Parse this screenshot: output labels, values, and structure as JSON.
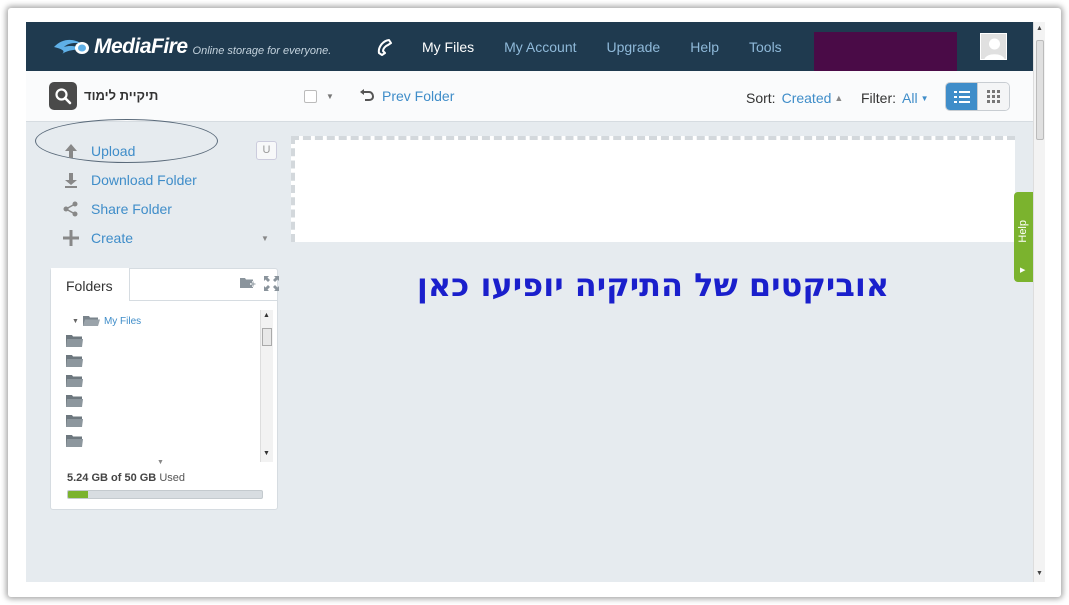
{
  "nav": {
    "brand": "MediaFire",
    "tagline": "Online storage for everyone.",
    "links": [
      {
        "label": "My Files",
        "active": true
      },
      {
        "label": "My Account"
      },
      {
        "label": "Upgrade"
      },
      {
        "label": "Help"
      },
      {
        "label": "Tools"
      }
    ],
    "icons": [
      "phone-icon",
      "avatar-icon"
    ]
  },
  "toolbar": {
    "folder_title": "תיקיית לימוד",
    "prev_folder": "Prev Folder",
    "sort_label": "Sort:",
    "sort_value": "Created",
    "filter_label": "Filter:",
    "filter_value": "All"
  },
  "sidebar": {
    "actions": [
      {
        "label": "Upload",
        "icon": "upload-icon"
      },
      {
        "label": "Download Folder",
        "icon": "download-icon"
      },
      {
        "label": "Share Folder",
        "icon": "share-icon"
      },
      {
        "label": "Create",
        "icon": "plus-icon"
      }
    ],
    "shortcut_key": "U",
    "folders_tab": "Folders",
    "tree_root": "My Files",
    "storage_used": "5.24 GB of 50 GB",
    "storage_suffix": "Used",
    "storage_fraction": 0.105
  },
  "main": {
    "message": "אוביקטים של התיקיה יופיעו כאן",
    "help_tab": "Help"
  },
  "colors": {
    "nav_bg": "#1f3a4f",
    "link": "#3f8dc9",
    "accent_green": "#7bb32e",
    "message": "#1a1fcc"
  }
}
